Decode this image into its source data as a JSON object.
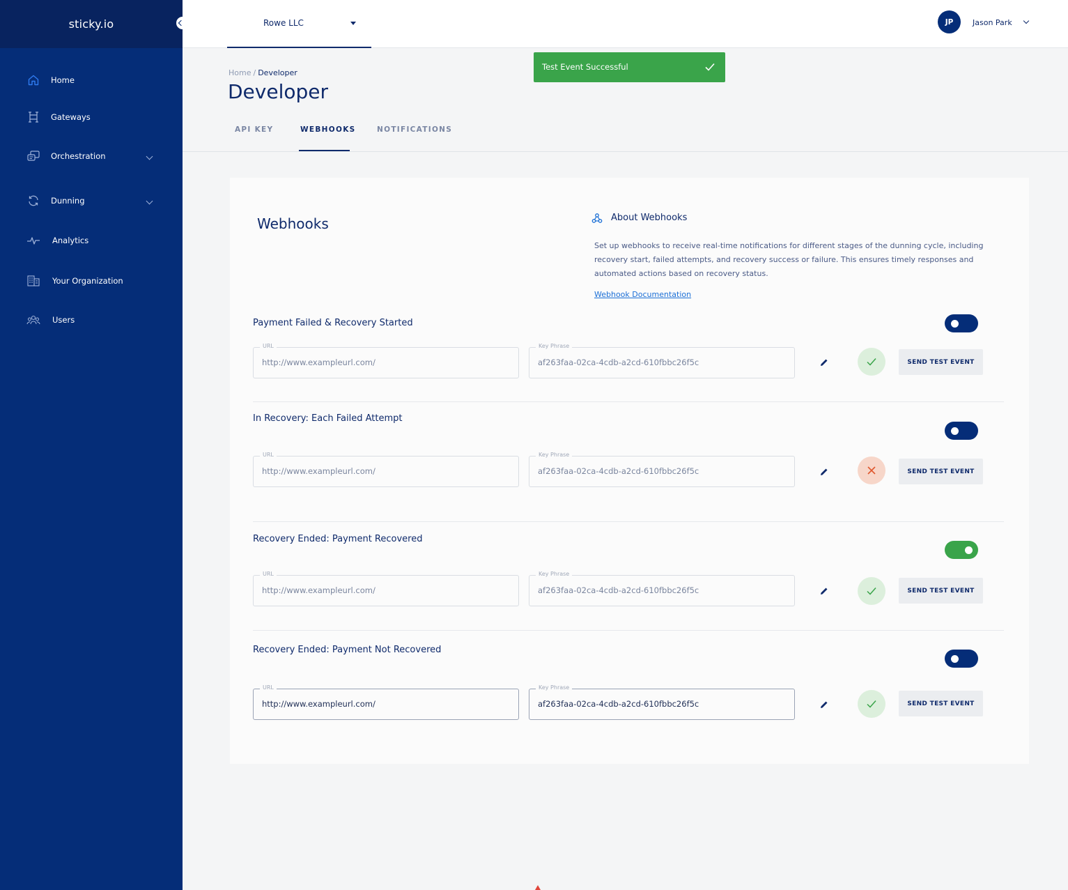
{
  "brand": "sticky.io",
  "sidebar": {
    "items": [
      {
        "label": "Home",
        "icon": "home-icon"
      },
      {
        "label": "Gateways",
        "icon": "gateway-icon"
      },
      {
        "label": "Orchestration",
        "icon": "orchestration-icon"
      },
      {
        "label": "Dunning",
        "icon": "refresh-icon"
      },
      {
        "label": "Analytics",
        "icon": "pulse-icon"
      },
      {
        "label": "Your Organization",
        "icon": "building-icon"
      },
      {
        "label": "Users",
        "icon": "users-icon"
      }
    ]
  },
  "topbar": {
    "org_name": "Rowe LLC",
    "user_initials": "JP",
    "user_name": "Jason Park"
  },
  "breadcrumb": {
    "home": "Home",
    "separator": "/",
    "current": "Developer"
  },
  "page_title": "Developer",
  "tabs": [
    {
      "label": "API KEY",
      "active": false
    },
    {
      "label": "WEBHOOKS",
      "active": true
    },
    {
      "label": "NOTIFICATIONS",
      "active": false
    }
  ],
  "toast": {
    "message": "Test Event Successful"
  },
  "card": {
    "title": "Webhooks",
    "about_title": "About Webhooks",
    "about_text": "Set up webhooks to receive real-time notifications for different stages of the dunning cycle, including recovery start, failed attempts, and recovery success or failure. This ensures timely responses and automated actions based on recovery status.",
    "doc_link": "Webhook Documentation"
  },
  "webhooks": [
    {
      "title": "Payment Failed &  Recovery Started",
      "enabled": false,
      "url_label": "URL",
      "url": "http://www.exampleurl.com/",
      "key_label": "Key Phrase",
      "key": "af263faa-02ca-4cdb-a2cd-610fbbc26f5c",
      "status": "success",
      "button": "SEND TEST EVENT"
    },
    {
      "title": "In Recovery: Each Failed Attempt",
      "enabled": false,
      "url_label": "URL",
      "url": "http://www.exampleurl.com/",
      "key_label": "Key Phrase",
      "key": "af263faa-02ca-4cdb-a2cd-610fbbc26f5c",
      "status": "failed",
      "button": "SEND TEST EVENT"
    },
    {
      "title": "Recovery Ended: Payment Recovered",
      "enabled": true,
      "url_label": "URL",
      "url": "http://www.exampleurl.com/",
      "key_label": "Key Phrase",
      "key": "af263faa-02ca-4cdb-a2cd-610fbbc26f5c",
      "status": "success",
      "button": "SEND TEST EVENT"
    },
    {
      "title": "Recovery Ended: Payment Not Recovered",
      "enabled": false,
      "url_label": "URL",
      "url": "http://www.exampleurl.com/",
      "key_label": "Key Phrase",
      "key": "af263faa-02ca-4cdb-a2cd-610fbbc26f5c",
      "status": "success",
      "button": "SEND TEST EVENT"
    }
  ],
  "colors": {
    "sidebar": "#052d78",
    "brand_bar": "#08235f",
    "primary": "#0f2a6b",
    "success": "#3aa44a",
    "fail": "#e0582f",
    "link": "#1b6fd6"
  }
}
